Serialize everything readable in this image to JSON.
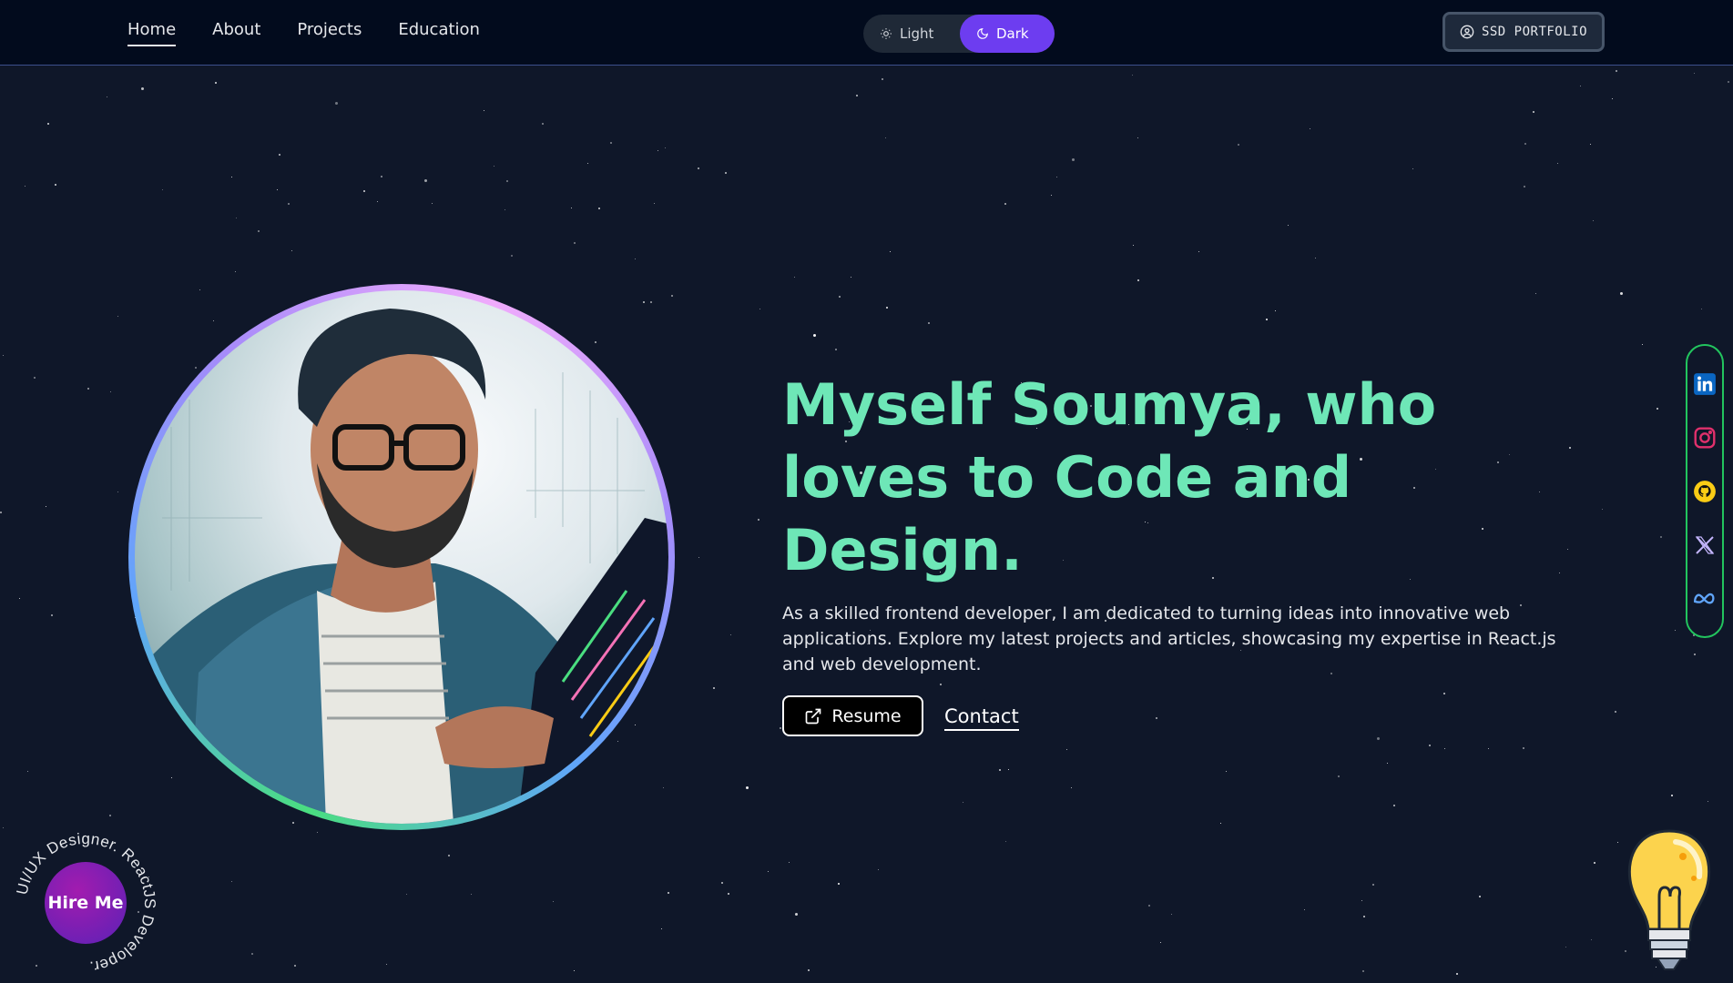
{
  "nav": {
    "links": [
      "Home",
      "About",
      "Projects",
      "Education"
    ],
    "active": "Home",
    "theme": {
      "light_label": "Light",
      "dark_label": "Dark",
      "selected": "Dark"
    },
    "brand_label": "SSD PORTFOLIO"
  },
  "hero": {
    "headline": "Myself Soumya, who loves to Code and Design.",
    "description": "As a skilled frontend developer, I am dedicated to turning ideas into innovative web applications. Explore my latest projects and articles, showcasing my expertise in React.js and web development.",
    "resume_label": "Resume",
    "contact_label": "Contact"
  },
  "social": [
    {
      "name": "linkedin-icon",
      "color": "#0a66c2"
    },
    {
      "name": "instagram-icon",
      "color": "#e1306c"
    },
    {
      "name": "github-icon",
      "color": "#facc15"
    },
    {
      "name": "x-twitter-icon",
      "color": "#c4b5fd"
    },
    {
      "name": "meta-icon",
      "color": "#60a5fa"
    }
  ],
  "hire": {
    "label": "Hire Me",
    "circular_text": "UI/UX Designer. ReactJS Developer."
  },
  "colors": {
    "background": "#0f1729",
    "accent": "#6ee7b7",
    "toggle_active": "#6d3df0"
  }
}
